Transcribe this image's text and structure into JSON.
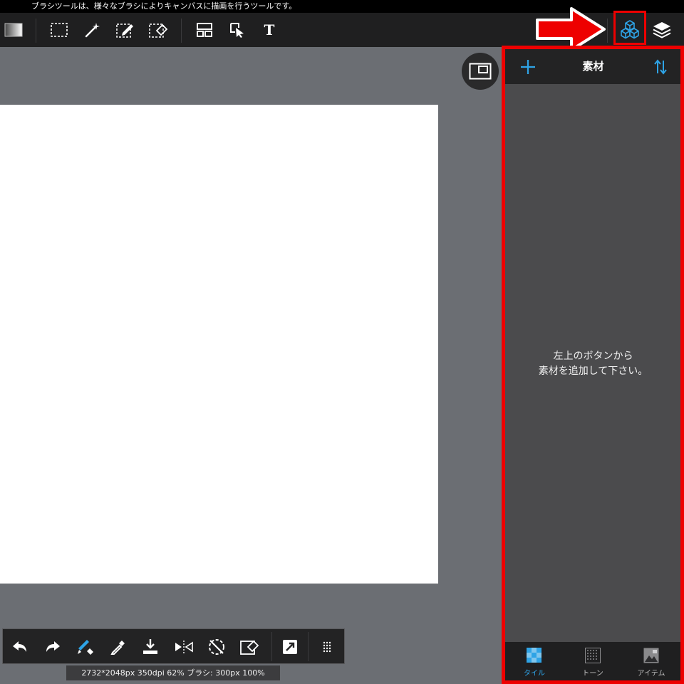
{
  "hint": {
    "text": "ブラシツールは、様々なブラシによりキャンバスに描画を行うツールです。"
  },
  "toolbar": {
    "items": [
      {
        "name": "color-gradient-icon"
      },
      {
        "name": "rect-select-icon"
      },
      {
        "name": "magic-wand-icon"
      },
      {
        "name": "select-pen-icon"
      },
      {
        "name": "select-eraser-icon"
      },
      {
        "name": "frame-divider-icon"
      },
      {
        "name": "operation-tool-icon"
      },
      {
        "name": "text-tool-icon",
        "label": "T"
      },
      {
        "name": "material-icon"
      },
      {
        "name": "layers-icon"
      }
    ],
    "accent": "#2ea3e6"
  },
  "panel": {
    "title": "素材",
    "empty_message_line1": "左上のボタンから",
    "empty_message_line2": "素材を追加して下さい。",
    "tabs": [
      {
        "label": "タイル",
        "icon": "tile-icon",
        "active": true
      },
      {
        "label": "トーン",
        "icon": "tone-icon",
        "active": false
      },
      {
        "label": "アイテム",
        "icon": "item-icon",
        "active": false
      }
    ]
  },
  "bottom_toolbar": {
    "items": [
      "undo-icon",
      "redo-icon",
      "brush-eraser-switch-icon",
      "eyedropper-icon",
      "import-icon",
      "flip-horizontal-icon",
      "rotate-reset-icon",
      "clear-selection-icon",
      "snap-icon",
      "more-grid-icon"
    ]
  },
  "status": {
    "text": "2732*2048px 350dpi 62% ブラシ: 300px 100%"
  },
  "highlight_color": "#ee0000"
}
